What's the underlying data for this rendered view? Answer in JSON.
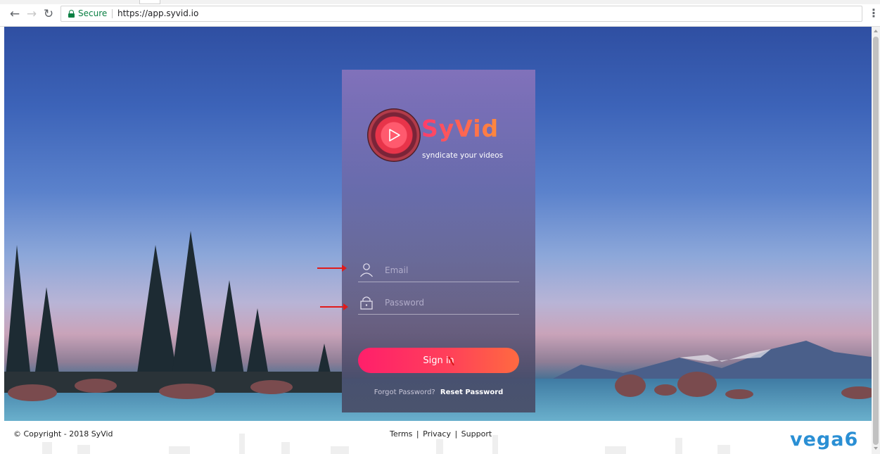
{
  "browser": {
    "secure_label": "Secure",
    "url": "https://app.syvid.io"
  },
  "brand": {
    "name": "SyVid",
    "tagline": "syndicate your videos"
  },
  "login": {
    "email_placeholder": "Email",
    "password_placeholder": "Password",
    "signin_label": "Sign in",
    "forgot_label": "Forgot Password?",
    "reset_label": "Reset Password"
  },
  "footer": {
    "copyright": "© Copyright - 2018 SyVid",
    "links": [
      "Terms",
      "Privacy",
      "Support"
    ],
    "separator": "|",
    "partner_logo": "vega6"
  },
  "colors": {
    "accent_start": "#ff1f6b",
    "accent_end": "#ff6a40",
    "secure_green": "#0b8043",
    "annotation_arrow": "#e01b1b"
  },
  "icons": {
    "back": "arrow-left-icon",
    "forward": "arrow-right-icon",
    "reload": "reload-icon",
    "lock": "lock-icon",
    "menu": "kebab-menu-icon",
    "user": "user-icon",
    "padlock": "padlock-icon",
    "play": "play-icon"
  }
}
